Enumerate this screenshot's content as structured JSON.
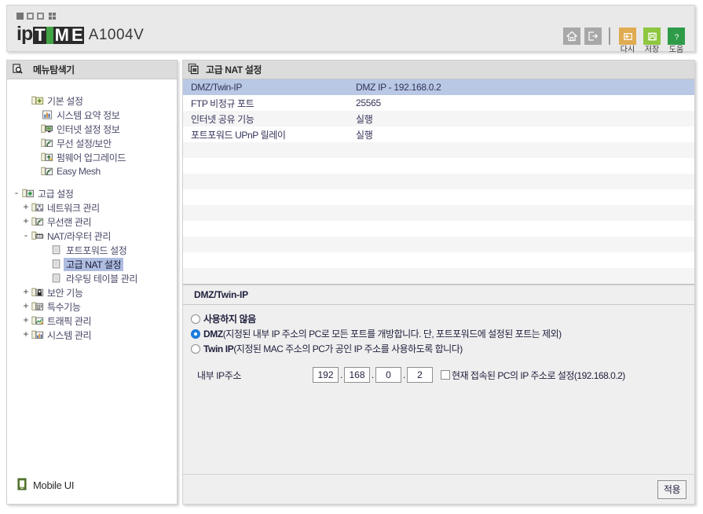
{
  "header": {
    "brand_ip": "ip",
    "brand_t": "T",
    "brand_m": "M",
    "brand_e": "E",
    "model": "A1004V",
    "window_buttons": [
      "minimize-box",
      "restore-box",
      "maximize-box",
      "grid-dots"
    ],
    "toolbar": {
      "home_name": "home-icon",
      "logout_name": "logout-icon",
      "actions": [
        {
          "label": "다시",
          "icon": "reset-icon",
          "color": "#e0ac51"
        },
        {
          "label": "저장",
          "icon": "save-icon",
          "color": "#8ec63f"
        },
        {
          "label": "도움",
          "icon": "help-icon",
          "color": "#2e9b48"
        }
      ]
    }
  },
  "sidebar": {
    "title": "메뉴탐색기",
    "title_icon": "menu-explorer-icon",
    "tree": [
      {
        "expander": "",
        "indent": 1,
        "icon": "folder-basic-icon",
        "label": "기본 설정",
        "type": "group",
        "selected": false
      },
      {
        "expander": "",
        "indent": 2,
        "icon": "chart-icon",
        "label": "시스템 요약 정보",
        "type": "leaf",
        "selected": false
      },
      {
        "expander": "",
        "indent": 2,
        "icon": "monitor-icon",
        "label": "인터넷 설정 정보",
        "type": "leaf",
        "selected": false
      },
      {
        "expander": "",
        "indent": 2,
        "icon": "wireless-icon",
        "label": "무선 설정/보안",
        "type": "leaf",
        "selected": false
      },
      {
        "expander": "",
        "indent": 2,
        "icon": "upgrade-icon",
        "label": "펌웨어 업그레이드",
        "type": "leaf",
        "selected": false
      },
      {
        "expander": "",
        "indent": 2,
        "icon": "wireless-icon",
        "label": "Easy Mesh",
        "type": "leaf",
        "selected": false
      },
      {
        "expander": "-",
        "indent": 0,
        "icon": "folder-advanced-icon",
        "label": "고급 설정",
        "type": "group",
        "selected": false
      },
      {
        "expander": "+",
        "indent": 1,
        "icon": "network-icon",
        "label": "네트워크 관리",
        "type": "group",
        "selected": false
      },
      {
        "expander": "+",
        "indent": 1,
        "icon": "wireless-icon",
        "label": "무선랜 관리",
        "type": "group",
        "selected": false
      },
      {
        "expander": "-",
        "indent": 1,
        "icon": "router-icon",
        "label": "NAT/라우터 관리",
        "type": "group",
        "selected": false
      },
      {
        "expander": "",
        "indent": 3,
        "icon": "page-icon",
        "label": "포트포워드 설정",
        "type": "leaf",
        "selected": false
      },
      {
        "expander": "",
        "indent": 3,
        "icon": "page-icon",
        "label": "고급 NAT 설정",
        "type": "leaf",
        "selected": true
      },
      {
        "expander": "",
        "indent": 3,
        "icon": "page-icon",
        "label": "라우팅 테이블 관리",
        "type": "leaf",
        "selected": false
      },
      {
        "expander": "+",
        "indent": 1,
        "icon": "lock-icon",
        "label": "보안 기능",
        "type": "group",
        "selected": false
      },
      {
        "expander": "+",
        "indent": 1,
        "icon": "special-icon",
        "label": "특수기능",
        "type": "group",
        "selected": false
      },
      {
        "expander": "+",
        "indent": 1,
        "icon": "traffic-icon",
        "label": "트래픽 관리",
        "type": "group",
        "selected": false
      },
      {
        "expander": "+",
        "indent": 1,
        "icon": "system-icon",
        "label": "시스템 관리",
        "type": "group",
        "selected": false
      }
    ],
    "mobile_ui": {
      "label": "Mobile UI",
      "icon": "mobile-phone-icon"
    }
  },
  "main": {
    "title": "고급 NAT 설정",
    "title_icon": "copy-pages-icon",
    "table": {
      "rows": [
        {
          "name": "DMZ/Twin-IP",
          "value": "DMZ IP - 192.168.0.2",
          "highlighted": true
        },
        {
          "name": "FTP 비정규 포트",
          "value": "25565",
          "highlighted": false
        },
        {
          "name": "인터넷 공유 기능",
          "value": "실행",
          "highlighted": false
        },
        {
          "name": "포트포워드 UPnP 릴레이",
          "value": "실행",
          "highlighted": false
        }
      ],
      "empty_row_count": 9
    },
    "section": {
      "title": "DMZ/Twin-IP",
      "options": [
        {
          "label": "사용하지 않음",
          "desc": "",
          "selected": false
        },
        {
          "label": "DMZ",
          "desc": " (지정된 내부 IP 주소의 PC로 모든 포트를 개방합니다. 단, 포트포워드에 설정된 포트는 제외)",
          "selected": true
        },
        {
          "label": "Twin IP",
          "desc": " (지정된 MAC 주소의 PC가 공인 IP 주소를 사용하도록 합니다)",
          "selected": false
        }
      ],
      "ip_label": "내부 IP주소",
      "ip_octets": [
        "192",
        "168",
        "0",
        "2"
      ],
      "ip_separator": ".",
      "checkbox_label": "현재 접속된 PC의 IP 주소로 설정(192.168.0.2)",
      "checkbox_checked": false
    },
    "apply_label": "적용"
  }
}
